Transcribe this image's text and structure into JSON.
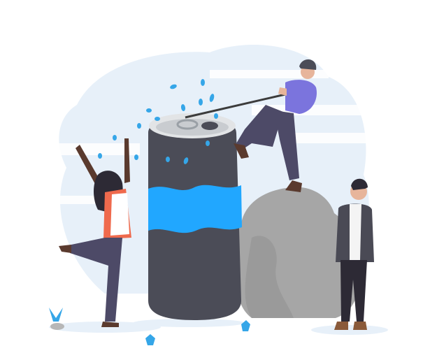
{
  "illustration": {
    "subject": "people-opening-giant-can",
    "colors": {
      "background_blob": "#e7f0f9",
      "can_body": "#4b4c57",
      "can_band": "#21a7ff",
      "can_top": "#e2e4e6",
      "water_drops": "#35a6e8",
      "rock": "#a6a6a6",
      "rock_shadow": "#8f8f8f",
      "climber_shirt": "#7b74dd",
      "trousers": "#4d4a67",
      "skin_dark": "#5a3a2e",
      "skin_light": "#e7b59b",
      "hair": "#2d2a35",
      "jacket": "#4a4a55",
      "plants": "#35a6e8"
    }
  }
}
